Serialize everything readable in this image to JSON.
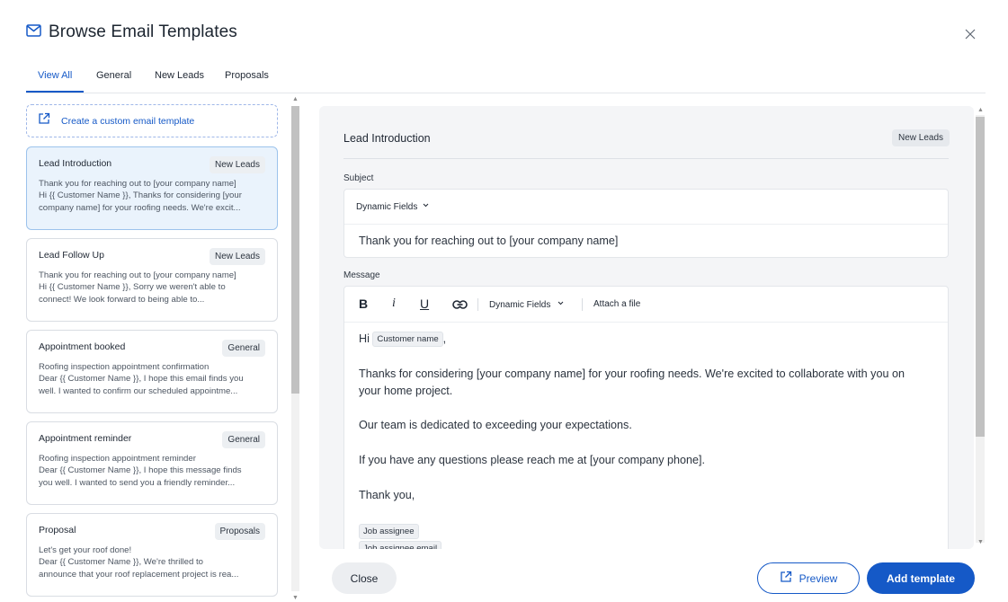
{
  "header": {
    "title": "Browse Email Templates",
    "icon": "mail-icon",
    "close_icon": "close-icon"
  },
  "tabs": [
    {
      "label": "View All",
      "active": true
    },
    {
      "label": "General",
      "active": false
    },
    {
      "label": "New Leads",
      "active": false
    },
    {
      "label": "Proposals",
      "active": false
    }
  ],
  "create_link": {
    "label": "Create a custom email template",
    "icon": "external-link-icon"
  },
  "templates": [
    {
      "name": "Lead Introduction",
      "badge": "New Leads",
      "line1": "Thank you for reaching out to [your company name]",
      "line2": "Hi {{ Customer Name }}, Thanks for considering [your",
      "line3": "company name] for your roofing needs. We're excit...",
      "selected": true
    },
    {
      "name": "Lead Follow Up",
      "badge": "New Leads",
      "line1": "Thank you for reaching out to [your company name]",
      "line2": "Hi {{ Customer Name }}, Sorry we weren't able to",
      "line3": "connect! We look forward to being able to...",
      "selected": false
    },
    {
      "name": "Appointment booked",
      "badge": "General",
      "line1": "Roofing inspection appointment confirmation",
      "line2": "Dear {{ Customer Name }}, I hope this email finds you",
      "line3": "well. I wanted to confirm our scheduled appointme...",
      "selected": false
    },
    {
      "name": "Appointment reminder",
      "badge": "General",
      "line1": "Roofing inspection appointment reminder",
      "line2": "Dear {{ Customer Name }}, I hope this message finds",
      "line3": "you well. I wanted to send you a friendly reminder...",
      "selected": false
    },
    {
      "name": "Proposal",
      "badge": "Proposals",
      "line1": "Let's get your roof done!",
      "line2": "Dear {{ Customer Name }}, We're thrilled to",
      "line3": "announce that your roof replacement project is rea...",
      "selected": false
    }
  ],
  "preview": {
    "title": "Lead Introduction",
    "badge": "New Leads",
    "subject_label": "Subject",
    "dynamic_fields_label": "Dynamic Fields",
    "subject_value": "Thank you for reaching out to [your company name]",
    "message_label": "Message",
    "toolbar": {
      "bold": "B",
      "italic": "i",
      "underline": "U",
      "dynamic_fields": "Dynamic Fields",
      "attach": "Attach a file"
    },
    "body": {
      "greeting": "Hi",
      "greeting_chip": "Customer name",
      "greeting_suffix": ",",
      "para1_line1": "Thanks for considering [your company name] for your roofing needs. We're excited to collaborate with you on",
      "para1_line2": "your home project.",
      "para2": "Our team is dedicated to exceeding your expectations.",
      "para3": "If you have any questions please reach me at [your company phone].",
      "signoff": "Thank you,",
      "chip1": "Job assignee",
      "chip2": "Job assignee email"
    }
  },
  "footer": {
    "close_label": "Close",
    "preview_label": "Preview",
    "add_label": "Add template"
  },
  "colors": {
    "accent": "#1559c7",
    "selected_bg": "#eaf3fc",
    "panel_bg": "#f4f5f7"
  }
}
